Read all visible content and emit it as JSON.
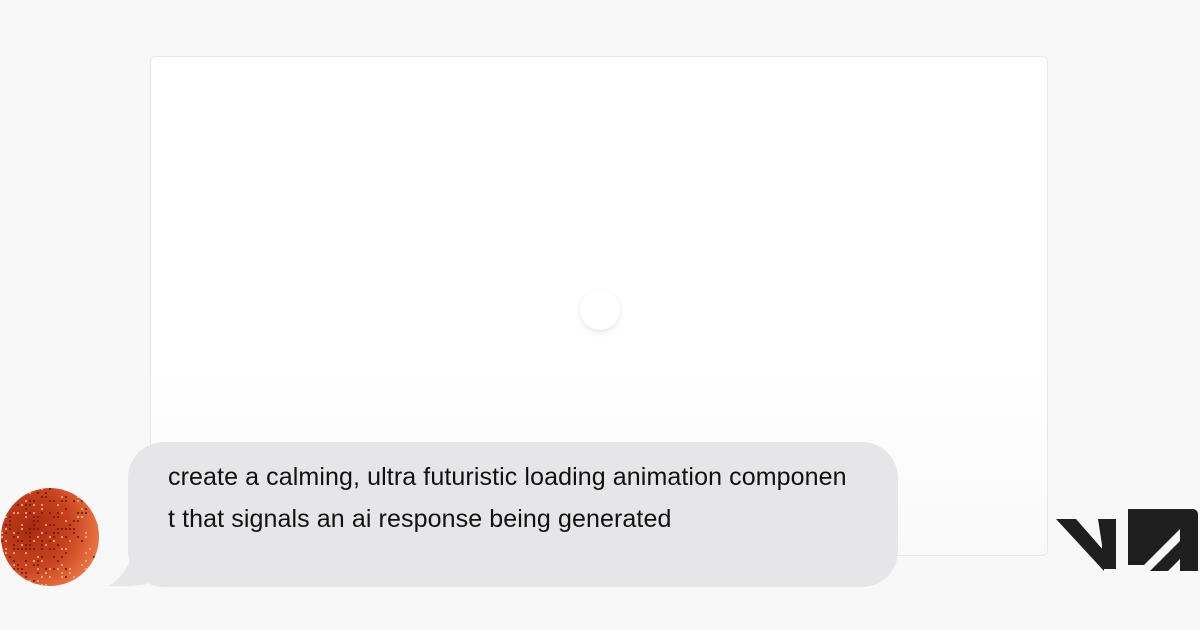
{
  "message": {
    "text": "create a calming, ultra futuristic loading animation component that signals an ai response being generated"
  },
  "icons": {
    "avatar": "user-avatar",
    "loader": "loading-spinner-icon",
    "logo": "v0-logo"
  },
  "colors": {
    "background": "#f8f8f8",
    "card": "#ffffff",
    "bubble": "#e6e6e8",
    "text": "#111111",
    "avatar_dark": "#a82a10",
    "avatar_light": "#ff8f5a",
    "logo": "#1f1f1f"
  }
}
